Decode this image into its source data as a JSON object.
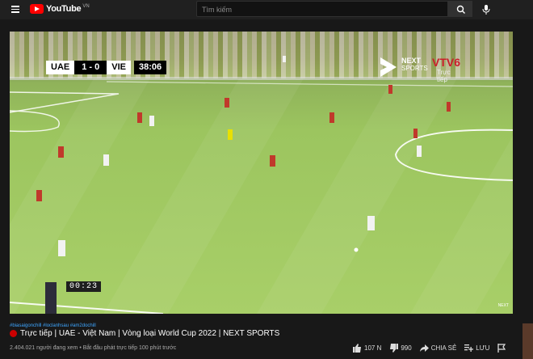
{
  "header": {
    "logo_text": "YouTube",
    "region": "VN",
    "search_placeholder": "Tìm kiếm"
  },
  "video": {
    "scoreboard": {
      "home": "UAE",
      "score": "1 - 0",
      "away": "VIE",
      "clock": "38:06"
    },
    "broadcaster": {
      "next_line1": "NEXT",
      "next_line2": "SPORTS",
      "vtv": "VTV6",
      "live": "Trực tiếp"
    },
    "overlay_timer": "00:23",
    "corner_logo": "NEXT"
  },
  "info": {
    "hashtags": "#biasaigonchill #loclanhsau #am2dochill",
    "title": "Trực tiếp | UAE - Việt Nam | Vòng loại World Cup 2022 | NEXT SPORTS",
    "meta": "2.404.021 người đang xem • Bắt đầu phát trực tiếp 100 phút trước",
    "likes": "107 N",
    "dislikes": "990",
    "share": "CHIA SẺ",
    "save": "LƯU"
  },
  "colors": {
    "accent": "#ff0000",
    "live": "#cc0000",
    "link": "#3ea6ff"
  }
}
